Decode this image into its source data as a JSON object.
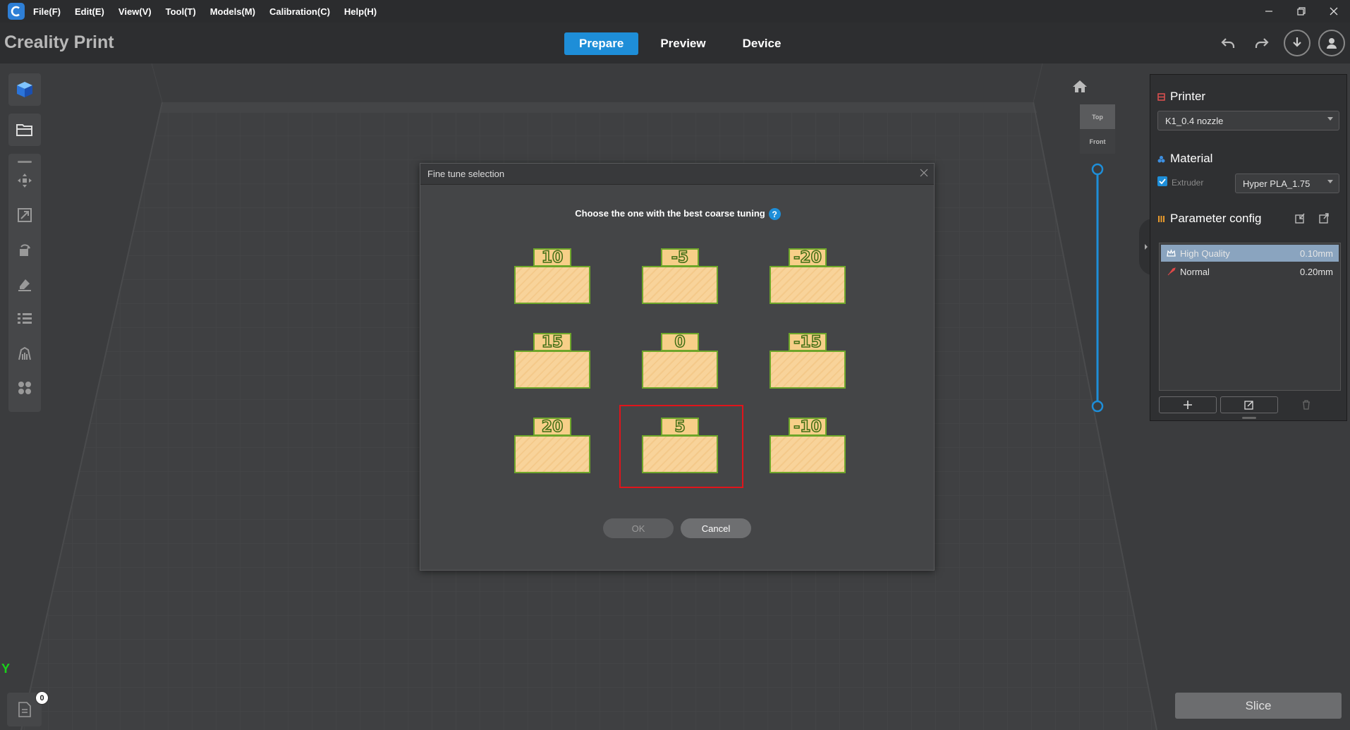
{
  "menu": {
    "items": [
      "File(F)",
      "Edit(E)",
      "View(V)",
      "Tool(T)",
      "Models(M)",
      "Calibration(C)",
      "Help(H)"
    ]
  },
  "app": {
    "title": "Creality Print"
  },
  "mode_tabs": {
    "prepare": "Prepare",
    "preview": "Preview",
    "device": "Device",
    "active": "Prepare"
  },
  "view_cube": {
    "top": "Top",
    "front": "Front"
  },
  "right_panel": {
    "printer": {
      "title": "Printer",
      "selected": "K1_0.4 nozzle"
    },
    "material": {
      "title": "Material",
      "extruder_label": "Extruder",
      "extruder_checked": true,
      "selected": "Hyper PLA_1.75"
    },
    "parameter_config": {
      "title": "Parameter config",
      "profiles": [
        {
          "name": "High Quality",
          "layer": "0.10mm",
          "selected": true
        },
        {
          "name": "Normal",
          "layer": "0.20mm",
          "selected": false
        }
      ]
    }
  },
  "slice": {
    "label": "Slice"
  },
  "file_list": {
    "count": "0"
  },
  "axis": {
    "y": "Y"
  },
  "dialog": {
    "title": "Fine tune selection",
    "prompt": "Choose the one with the best coarse tuning",
    "help": "?",
    "options": [
      "10",
      "-5",
      "-20",
      "15",
      "0",
      "-15",
      "20",
      "5",
      "-10"
    ],
    "selected": "5",
    "ok": "OK",
    "cancel": "Cancel"
  },
  "colors": {
    "accent": "#1e8ed8",
    "selection_border": "#e0141b",
    "specimen_fill": "#f8d39a",
    "specimen_outline": "#6ea62a"
  }
}
